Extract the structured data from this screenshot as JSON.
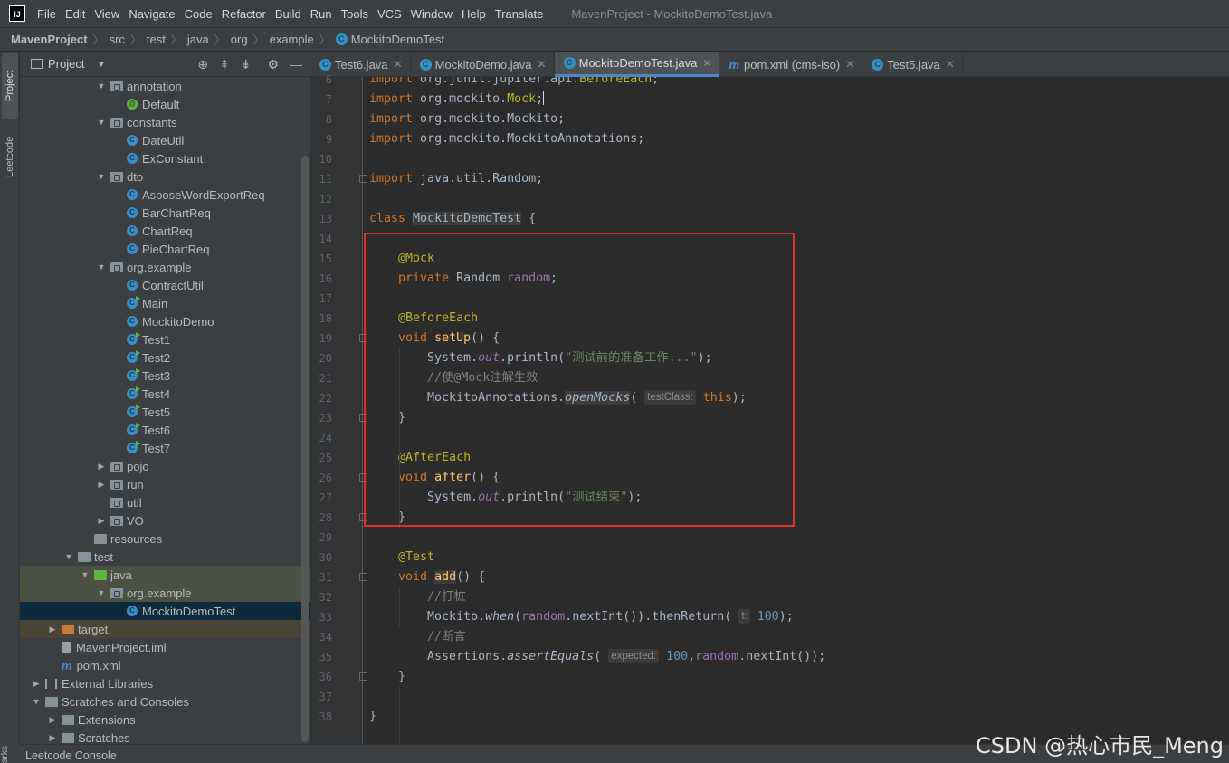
{
  "menubar": {
    "logo": "IJ",
    "items": [
      "File",
      "Edit",
      "View",
      "Navigate",
      "Code",
      "Refactor",
      "Build",
      "Run",
      "Tools",
      "VCS",
      "Window",
      "Help",
      "Translate"
    ],
    "title": "MavenProject - MockitoDemoTest.java"
  },
  "breadcrumb": [
    "MavenProject",
    "src",
    "test",
    "java",
    "org",
    "example",
    "MockitoDemoTest"
  ],
  "side_tabs": {
    "project": "Project",
    "leetcode": "Leetcode",
    "bookmarks": "arks"
  },
  "project_panel": {
    "title": "Project",
    "tools": [
      "locate-icon",
      "expand-all-icon",
      "collapse-all-icon",
      "gear-icon",
      "hide-icon"
    ]
  },
  "tree": [
    {
      "label": "annotation",
      "type": "package",
      "indent": 1,
      "arrow": "down"
    },
    {
      "label": "Default",
      "type": "annotation",
      "indent": 2
    },
    {
      "label": "constants",
      "type": "package",
      "indent": 1,
      "arrow": "down"
    },
    {
      "label": "DateUtil",
      "type": "class",
      "indent": 2
    },
    {
      "label": "ExConstant",
      "type": "class",
      "indent": 2
    },
    {
      "label": "dto",
      "type": "package",
      "indent": 1,
      "arrow": "down"
    },
    {
      "label": "AsposeWordExportReq",
      "type": "class",
      "indent": 2
    },
    {
      "label": "BarChartReq",
      "type": "class",
      "indent": 2
    },
    {
      "label": "ChartReq",
      "type": "class",
      "indent": 2
    },
    {
      "label": "PieChartReq",
      "type": "class",
      "indent": 2
    },
    {
      "label": "org.example",
      "type": "package",
      "indent": 1,
      "arrow": "down"
    },
    {
      "label": "ContractUtil",
      "type": "class",
      "indent": 2
    },
    {
      "label": "Main",
      "type": "class-run",
      "indent": 2
    },
    {
      "label": "MockitoDemo",
      "type": "class",
      "indent": 2
    },
    {
      "label": "Test1",
      "type": "class-run",
      "indent": 2
    },
    {
      "label": "Test2",
      "type": "class-run",
      "indent": 2
    },
    {
      "label": "Test3",
      "type": "class-run",
      "indent": 2
    },
    {
      "label": "Test4",
      "type": "class-run",
      "indent": 2
    },
    {
      "label": "Test5",
      "type": "class-run",
      "indent": 2
    },
    {
      "label": "Test6",
      "type": "class-run",
      "indent": 2
    },
    {
      "label": "Test7",
      "type": "class-run",
      "indent": 2
    },
    {
      "label": "pojo",
      "type": "package",
      "indent": 1,
      "arrow": "right"
    },
    {
      "label": "run",
      "type": "package",
      "indent": 1,
      "arrow": "right"
    },
    {
      "label": "util",
      "type": "package",
      "indent": 1
    },
    {
      "label": "VO",
      "type": "package",
      "indent": 1,
      "arrow": "right"
    },
    {
      "label": "resources",
      "type": "resources",
      "indent": 0
    },
    {
      "label": "test",
      "type": "folder",
      "indent": -1,
      "arrow": "down"
    },
    {
      "label": "java",
      "type": "source",
      "indent": 0,
      "arrow": "down",
      "bg": "green"
    },
    {
      "label": "org.example",
      "type": "package",
      "indent": 1,
      "arrow": "down",
      "bg": "green"
    },
    {
      "label": "MockitoDemoTest",
      "type": "class",
      "indent": 2,
      "bg": "selected"
    },
    {
      "label": "target",
      "type": "target",
      "indent": -2,
      "arrow": "right",
      "bg": "brown"
    },
    {
      "label": "MavenProject.iml",
      "type": "iml",
      "indent": -2
    },
    {
      "label": "pom.xml",
      "type": "maven",
      "indent": -2
    },
    {
      "label": "External Libraries",
      "type": "library",
      "indent": -3,
      "arrow": "right"
    },
    {
      "label": "Scratches and Consoles",
      "type": "scratch",
      "indent": -3,
      "arrow": "down"
    },
    {
      "label": "Extensions",
      "type": "folder",
      "indent": -2,
      "arrow": "right"
    },
    {
      "label": "Scratches",
      "type": "folder",
      "indent": -2,
      "arrow": "right"
    }
  ],
  "tabs": [
    {
      "label": "Test6.java",
      "icon": "class"
    },
    {
      "label": "MockitoDemo.java",
      "icon": "class"
    },
    {
      "label": "MockitoDemoTest.java",
      "icon": "class",
      "active": true
    },
    {
      "label": "pom.xml (cms-iso)",
      "icon": "maven"
    },
    {
      "label": "Test5.java",
      "icon": "class"
    }
  ],
  "code_lines": [
    {
      "n": "6",
      "html": "<span class='kw'>import</span> org.junit.jupiter.api.<span class='an'>BeforeEach</span>;"
    },
    {
      "n": "7",
      "html": "<span class='kw'>import</span> org.mockito.<span class='an'>Mock</span>;<span class='caret'></span>"
    },
    {
      "n": "8",
      "html": "<span class='kw'>import</span> org.mockito.Mockito;"
    },
    {
      "n": "9",
      "html": "<span class='kw'>import</span> org.mockito.MockitoAnnotations;"
    },
    {
      "n": "10",
      "html": ""
    },
    {
      "n": "11",
      "html": "<span class='kw'>import</span> java.util.Random;"
    },
    {
      "n": "12",
      "html": ""
    },
    {
      "n": "13",
      "html": "<span class='kw'>class</span> <span class='hl'>MockitoDemoTest</span> {"
    },
    {
      "n": "14",
      "html": ""
    },
    {
      "n": "15",
      "html": "    <span class='an'>@Mock</span>"
    },
    {
      "n": "16",
      "html": "    <span class='kw'>private</span> Random <span class='fld'>random</span>;"
    },
    {
      "n": "17",
      "html": ""
    },
    {
      "n": "18",
      "html": "    <span class='an'>@BeforeEach</span>"
    },
    {
      "n": "19",
      "html": "    <span class='kw'>void</span> <span class='fn'>setUp</span>() {"
    },
    {
      "n": "20",
      "html": "        System.<span class='fld it'>out</span>.println(<span class='str'>\"测试前的准备工作...\"</span>);"
    },
    {
      "n": "21",
      "html": "        <span class='cm'>//使@Mock注解生效</span>"
    },
    {
      "n": "22",
      "html": "        MockitoAnnotations.<span class='it hl'>openMocks</span>( <span class='hint'>testClass:</span> <span class='kw'>this</span>);"
    },
    {
      "n": "23",
      "html": "    }"
    },
    {
      "n": "24",
      "html": ""
    },
    {
      "n": "25",
      "html": "    <span class='an'>@AfterEach</span>"
    },
    {
      "n": "26",
      "html": "    <span class='kw'>void</span> <span class='fn'>after</span>() {"
    },
    {
      "n": "27",
      "html": "        System.<span class='fld it'>out</span>.println(<span class='str'>\"测试结束\"</span>);"
    },
    {
      "n": "28",
      "html": "    }"
    },
    {
      "n": "29",
      "html": ""
    },
    {
      "n": "30",
      "html": "    <span class='an'>@Test</span>"
    },
    {
      "n": "31",
      "html": "    <span class='kw'>void</span> <span class='fn hl'>add</span>() {"
    },
    {
      "n": "32",
      "html": "        <span class='cm'>//打桩</span>"
    },
    {
      "n": "33",
      "html": "        Mockito.<span class='it'>when</span>(<span class='fld'>random</span>.nextInt()).thenReturn( <span class='hint'>t:</span> <span class='num'>100</span>);"
    },
    {
      "n": "34",
      "html": "        <span class='cm'>//断言</span>"
    },
    {
      "n": "35",
      "html": "        Assertions.<span class='it'>assertEquals</span>( <span class='hint'>expected:</span> <span class='num'>100</span>,<span class='fld'>random</span>.nextInt());"
    },
    {
      "n": "36",
      "html": "    }"
    },
    {
      "n": "37",
      "html": ""
    },
    {
      "n": "38",
      "html": "}"
    }
  ],
  "bottom": {
    "label": "Leetcode Console"
  },
  "watermark": "CSDN @热心市民_Meng"
}
